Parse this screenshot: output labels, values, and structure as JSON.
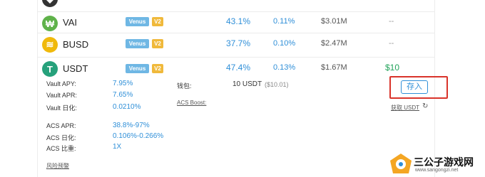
{
  "rows": [
    {
      "symbol": "VAI",
      "badge1": "Venus",
      "badge2": "V2",
      "apy": "43.1%",
      "pct": "0.11%",
      "tvl": "$3.01M",
      "extra": "--",
      "color": "#5fb24a",
      "glyph": "₩"
    },
    {
      "symbol": "BUSD",
      "badge1": "Venus",
      "badge2": "V2",
      "apy": "37.7%",
      "pct": "0.10%",
      "tvl": "$2.47M",
      "extra": "--",
      "color": "#f0b90b",
      "glyph": "≋"
    },
    {
      "symbol": "USDT",
      "badge1": "Venus",
      "badge2": "V2",
      "apy": "47.4%",
      "pct": "0.13%",
      "tvl": "$1.67M",
      "extra": "$10",
      "color": "#26a17b",
      "glyph": "T"
    }
  ],
  "details": {
    "vault_apy_label": "Vault APY:",
    "vault_apy": "7.95%",
    "vault_apr_label": "Vault APR:",
    "vault_apr": "7.65%",
    "vault_daily_label": "Vault 日化:",
    "vault_daily": "0.0210%",
    "acs_apr_label": "ACS APR:",
    "acs_apr": "38.8%-97%",
    "acs_daily_label": "ACS 日化:",
    "acs_daily": "0.106%-0.266%",
    "acs_ratio_label": "ACS 比重:",
    "acs_ratio": "1X",
    "risk_label": "风险预警",
    "wallet_label": "钱包:",
    "wallet_value": "10 USDT",
    "wallet_usd": "($10.01)",
    "acs_boost_label": "ACS Boost:",
    "deposit_label": "存入",
    "get_usdt_label": "获取 USDT"
  },
  "watermark": {
    "text": "三公子游戏网",
    "url": "www.sangongzi.net"
  },
  "colors": {
    "accent": "#2f8fd8",
    "green": "#22a35a",
    "highlight_box": "#d9332a"
  }
}
